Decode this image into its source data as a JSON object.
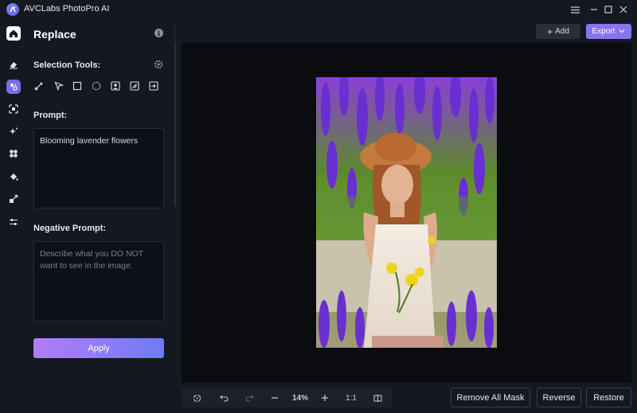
{
  "app": {
    "title": "AVCLabs PhotoPro AI"
  },
  "window_controls": [
    "menu-icon",
    "minimize-icon",
    "maximize-icon",
    "close-icon"
  ],
  "rail": {
    "items": [
      {
        "icon": "home-icon"
      },
      {
        "icon": "eraser-icon"
      },
      {
        "icon": "replace-icon",
        "active": true
      },
      {
        "icon": "expand-icon"
      },
      {
        "icon": "sparkle-icon"
      },
      {
        "icon": "fan-icon"
      },
      {
        "icon": "paint-bucket-icon"
      },
      {
        "icon": "resize-icon"
      },
      {
        "icon": "sliders-icon"
      }
    ]
  },
  "panel": {
    "title": "Replace",
    "selection_tools_label": "Selection Tools:",
    "tools": [
      "brush-icon",
      "polygon-lasso-icon",
      "rectangle-select-icon",
      "ellipse-select-icon",
      "person-select-icon",
      "object-select-icon",
      "import-mask-icon"
    ],
    "prompt_label": "Prompt:",
    "prompt_value": "Blooming lavender flowers",
    "negative_prompt_label": "Negative Prompt:",
    "negative_prompt_placeholder": "Describe what you DO NOT want to see in the image.",
    "apply_label": "Apply"
  },
  "toolbar": {
    "add_label": "Add",
    "export_label": "Export"
  },
  "bottom": {
    "zoom": "14%",
    "ratio": "1:1",
    "remove_all_mask_label": "Remove All Mask",
    "reverse_label": "Reverse",
    "restore_label": "Restore"
  },
  "colors": {
    "accent": "#8a73ee",
    "apply_gradient_start": "#b27cf5",
    "apply_gradient_end": "#6f7bf7",
    "background": "#141821",
    "canvas": "#0a0c10"
  }
}
